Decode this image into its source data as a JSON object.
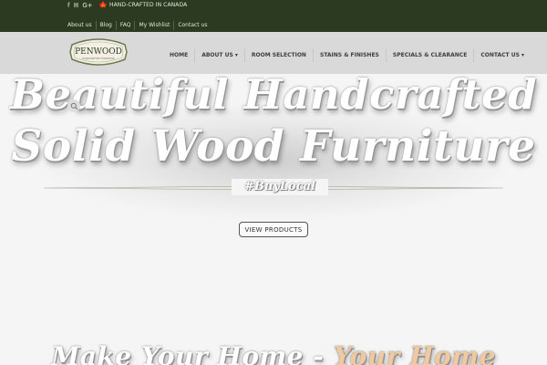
{
  "topbar": {
    "social": [
      {
        "icon": "facebook-icon",
        "glyph": "f"
      },
      {
        "icon": "email-icon",
        "glyph": "✉"
      },
      {
        "icon": "google-plus-icon",
        "glyph": "G+"
      }
    ],
    "made_in": "HAND-CRAFTED IN CANADA",
    "links": [
      "About us",
      "Blog",
      "FAQ",
      "My Wishlist",
      "Contact us"
    ]
  },
  "header": {
    "logo_text": "PENWOOD",
    "logo_tagline": "HANDCRAFTED FURNITURE",
    "nav": [
      "HOME",
      "ABOUT US ▾",
      "ROOM SELECTION",
      "STAINS & FINISHES",
      "SPECIALS & CLEARANCE",
      "CONTACT US ▾"
    ]
  },
  "hero": {
    "line1": "Beautiful Handcrafted",
    "line2": "Solid Wood Furniture",
    "hashtag": "#BuyLocal",
    "cta": "VIEW PRODUCTS",
    "line3_part1": "Make Your Home - ",
    "line3_part2": "Your Home"
  },
  "colors": {
    "topbar": "#2c3a22",
    "header": "#d9d9d9",
    "hero_bg": "#f5f5f5",
    "logo_border": "#6b7a4c",
    "maple_leaf": "#d22b2b"
  }
}
